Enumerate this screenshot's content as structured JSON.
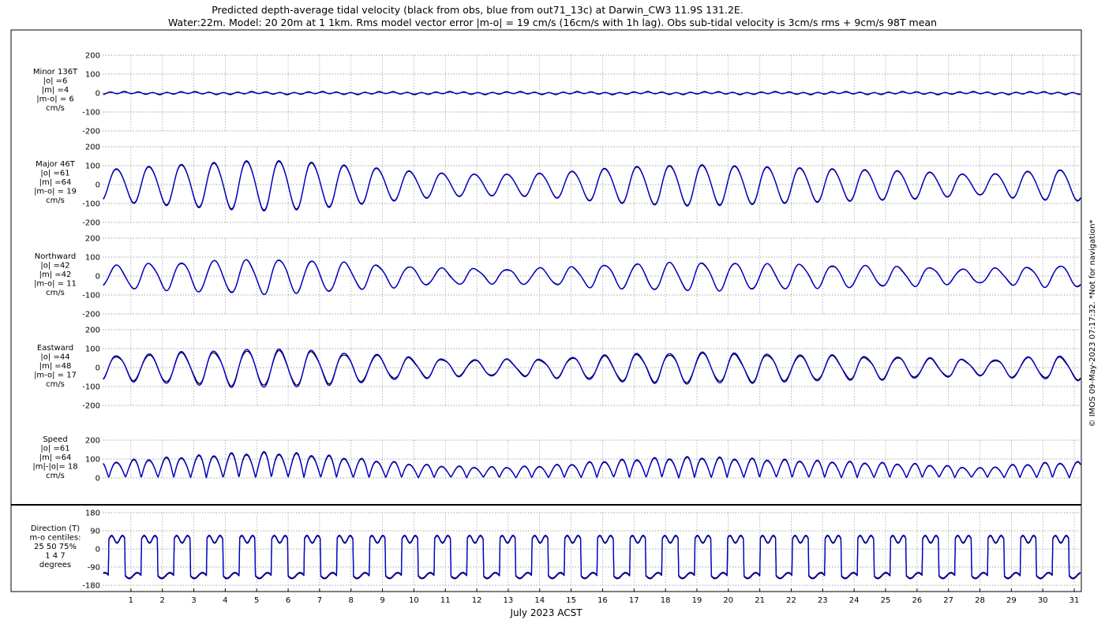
{
  "title_lines": [
    "Predicted depth-average tidal velocity (black from obs, blue from out71_13c) at Darwin_CW3 11.9S 131.2E.",
    "Water:22m. Model: 20 20m at 1 1km. Rms model vector error |m-o| = 19 cm/s (16cm/s with 1h lag). Obs sub-tidal velocity is 3cm/s rms + 9cm/s 98T mean"
  ],
  "side_note": "© IMOS 09-May-2023 07:17:32.  *Not for navigation*",
  "colors": {
    "obs": "#000000",
    "model": "#0000cc",
    "grid": "#888888",
    "frame": "#000000"
  },
  "chart_data": {
    "type": "line",
    "xlabel": "July 2023 ACST",
    "x_ticks": [
      1,
      2,
      3,
      4,
      5,
      6,
      7,
      8,
      9,
      10,
      11,
      12,
      13,
      14,
      15,
      16,
      17,
      18,
      19,
      20,
      21,
      22,
      23,
      24,
      25,
      26,
      27,
      28,
      29,
      30,
      31
    ],
    "xlim": [
      0.1,
      31.2
    ],
    "grid": true,
    "series_legend": {
      "obs": "black from obs",
      "model": "blue from out71_13c"
    },
    "panels": [
      {
        "id": "minor",
        "label": [
          "Minor 136T",
          "|o| =6",
          "|m| =4",
          "|m-o| = 6",
          "cm/s"
        ],
        "ylim": [
          -200,
          200
        ],
        "yticks": [
          -200,
          -100,
          0,
          100,
          200
        ],
        "amplitude_cm_s": {
          "obs": 6,
          "model": 4
        }
      },
      {
        "id": "major",
        "label": [
          "Major 46T",
          "|o| =61",
          "|m| =64",
          "|m-o| = 19",
          "cm/s"
        ],
        "ylim": [
          -200,
          200
        ],
        "yticks": [
          -200,
          -100,
          0,
          100,
          200
        ],
        "amplitude_cm_s": {
          "obs": 61,
          "model": 64
        }
      },
      {
        "id": "north",
        "label": [
          "Northward",
          "|o| =42",
          "|m| =42",
          "|m-o| = 11",
          "cm/s"
        ],
        "ylim": [
          -200,
          200
        ],
        "yticks": [
          -200,
          -100,
          0,
          100,
          200
        ],
        "amplitude_cm_s": {
          "obs": 42,
          "model": 42
        }
      },
      {
        "id": "east",
        "label": [
          "Eastward",
          "|o| =44",
          "|m| =48",
          "|m-o| = 17",
          "cm/s"
        ],
        "ylim": [
          -200,
          200
        ],
        "yticks": [
          -200,
          -100,
          0,
          100,
          200
        ],
        "amplitude_cm_s": {
          "obs": 44,
          "model": 48
        }
      },
      {
        "id": "speed",
        "label": [
          "Speed",
          "|o| =61",
          "|m| =64",
          "|m|-|o|= 18",
          "cm/s"
        ],
        "ylim": [
          0,
          200
        ],
        "yticks": [
          0,
          100,
          200
        ],
        "amplitude_cm_s": {
          "obs": 61,
          "model": 64
        }
      },
      {
        "id": "dir",
        "label": [
          "Direction (T)",
          "m-o centiles:",
          "25  50  75%",
          "1   4   7",
          "degrees"
        ],
        "ylim": [
          -180,
          180
        ],
        "yticks": [
          -180,
          -90,
          0,
          90,
          180
        ],
        "flood_deg": 46,
        "ebb_deg": -134
      }
    ],
    "tidal_envelope": {
      "days": [
        0,
        1,
        2,
        3,
        4,
        5,
        6,
        7,
        8,
        9,
        10,
        11,
        12,
        13,
        14,
        15,
        16,
        17,
        18,
        19,
        20,
        21,
        22,
        23,
        24,
        25,
        26,
        27,
        28,
        29,
        30,
        31.2
      ],
      "major_amplitude_cm_s": [
        75,
        90,
        100,
        110,
        120,
        128,
        125,
        115,
        100,
        85,
        70,
        60,
        55,
        55,
        60,
        70,
        85,
        95,
        100,
        105,
        100,
        95,
        90,
        85,
        80,
        75,
        70,
        60,
        50,
        65,
        75,
        80
      ]
    }
  }
}
